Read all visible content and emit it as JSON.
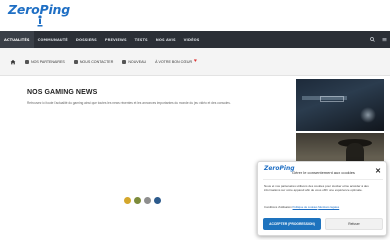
{
  "header": {
    "logo_text": "ZeroPing"
  },
  "nav": {
    "items": [
      {
        "label": "ACTUALITÉS",
        "active": true
      },
      {
        "label": "COMMUNAUTÉ"
      },
      {
        "label": "DOSSIERS"
      },
      {
        "label": "PREVIEWS"
      },
      {
        "label": "TESTS"
      },
      {
        "label": "NOS AVIS"
      },
      {
        "label": "VIDÉOS"
      }
    ]
  },
  "subbar": {
    "items": [
      {
        "label": "NOS PARTENAIRES"
      },
      {
        "label": "NOUS CONTACTER"
      },
      {
        "label": "NOUVEAU"
      },
      {
        "label": "À VOTRE BON CŒUR"
      }
    ]
  },
  "main": {
    "title": "NOS GAMING NEWS",
    "description": "Retrouvez ici toute l'actualité du gaming ainsi que toutes les news récentes et les annonces importantes du monde du jeu vidéo et des consoles."
  },
  "loader": {
    "colors": [
      "#d4a72c",
      "#7c8b3a",
      "#8e8e8e",
      "#2c5a8c"
    ]
  },
  "cookie_modal": {
    "logo_text": "ZeroPing",
    "title": "Gérer le consentement aux cookies",
    "body": "Nous et nos partenaires utilisons des cookies pour stocker et/ou accéder à des informations sur votre appareil afin de vous offrir une expérience optimale.",
    "links_prefix": "Conditions d'utilisation",
    "link_1": "Politique de cookies",
    "link_2": "Mentions légales",
    "accept_label": "ACCEPTER (PROGRESSION)",
    "refuse_label": "Refuser"
  }
}
